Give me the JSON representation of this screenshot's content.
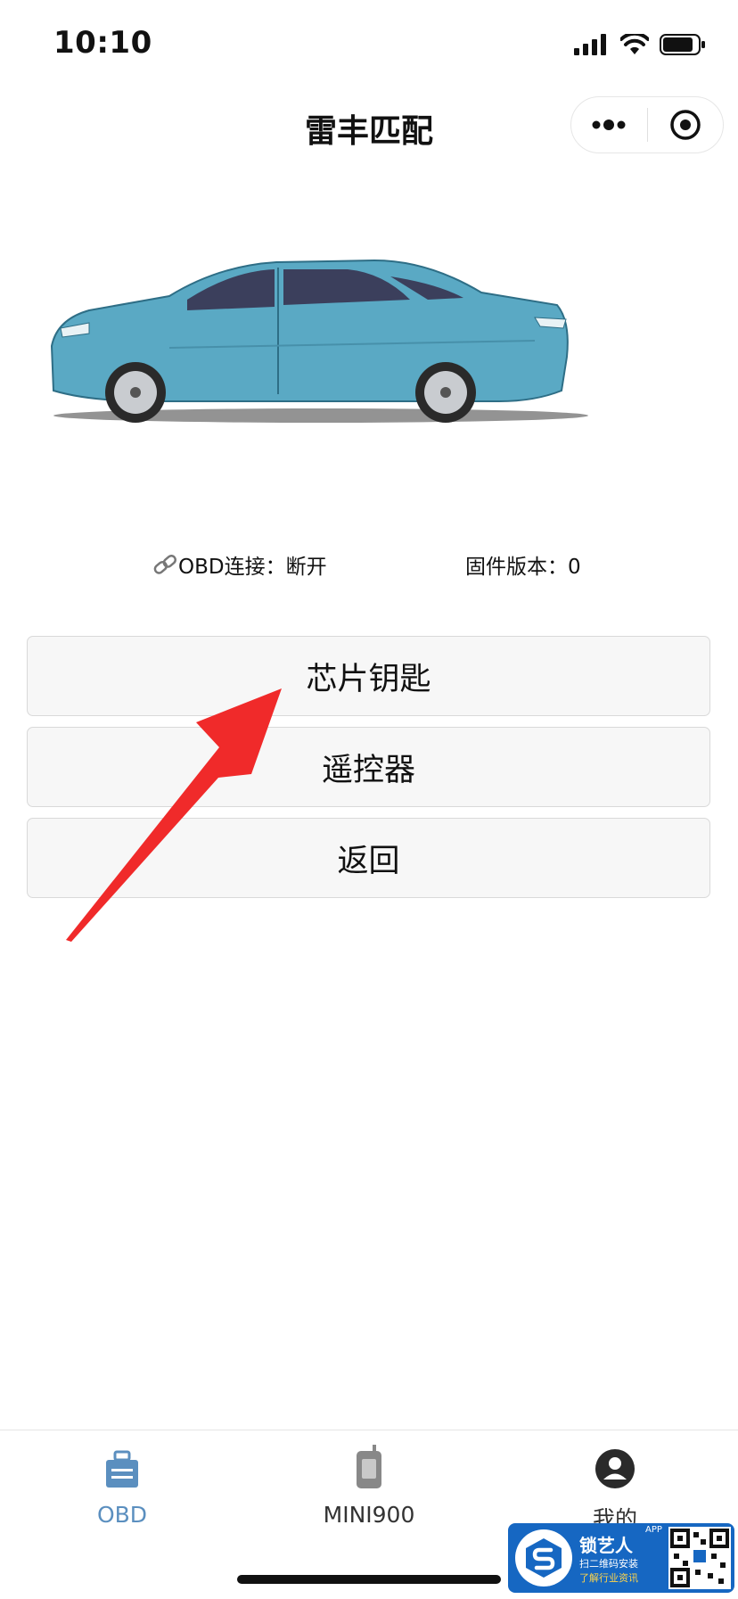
{
  "status_bar": {
    "time": "10:10"
  },
  "nav": {
    "title": "雷丰匹配"
  },
  "info": {
    "obd_connection": "OBD连接：断开",
    "firmware_version": "固件版本：0"
  },
  "buttons": {
    "chip_key": "芯片钥匙",
    "remote": "遥控器",
    "back": "返回"
  },
  "tab_bar": {
    "items": [
      {
        "label": "OBD",
        "icon": "obd-icon",
        "active": true
      },
      {
        "label": "MINI900",
        "icon": "device-icon",
        "active": false
      },
      {
        "label": "我的",
        "icon": "user-icon",
        "active": false
      }
    ]
  },
  "watermark": {
    "title": "锁艺人",
    "badge": "APP",
    "line1": "扫二维码安装",
    "line2": "了解行业资讯"
  },
  "colors": {
    "accent": "#5b8fbf",
    "annotation_arrow": "#f02a2a",
    "car_body": "#5aa9c4",
    "watermark_bg": "#1667c2"
  }
}
